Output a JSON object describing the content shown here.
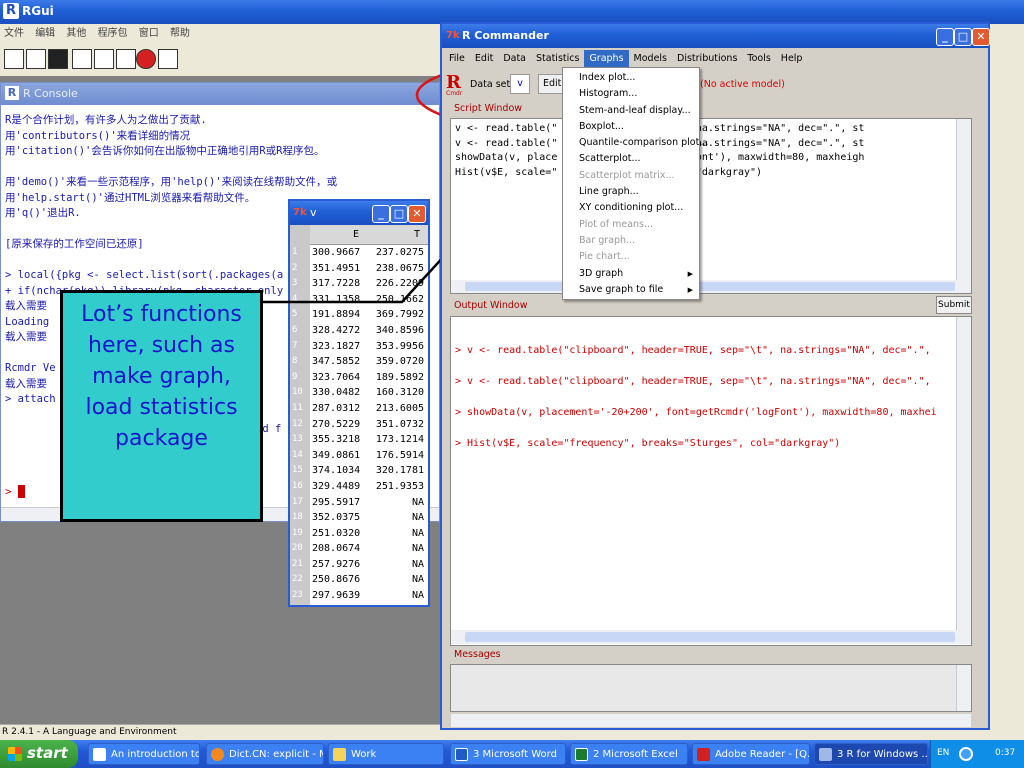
{
  "rgui": {
    "title": "RGui",
    "menu": [
      "文件",
      "编辑",
      "其他",
      "程序包",
      "窗口",
      "帮助"
    ],
    "status": "R 2.4.1 - A Language and Environment"
  },
  "console": {
    "title": "R Console",
    "lines": [
      "R是个合作计划，有许多人为之做出了贡献.",
      "用'contributors()'来看详细的情况",
      "用'citation()'会告诉你如何在出版物中正确地引用R或R程序包。",
      "",
      "用'demo()'来看一些示范程序，用'help()'来阅读在线帮助文件，或",
      "用'help.start()'通过HTML浏览器来看帮助文件。",
      "用'q()'退出R.",
      "",
      "[原来保存的工作空间已还原]",
      "",
      "> local({pkg <- select.list(sort(.packages(a",
      "+ if(nchar(pkg)) library(pkg, character.only",
      "载入需要",
      "Loading",
      "载入需要",
      "",
      "Rcmdr Ve",
      "载入需要",
      "> attach"
    ],
    "extra": "ed f",
    "prompt": ">"
  },
  "viewer": {
    "title": "v",
    "headers": [
      "E",
      "T"
    ],
    "rows": [
      [
        "1",
        "300.9667",
        "237.0275"
      ],
      [
        "2",
        "351.4951",
        "238.0675"
      ],
      [
        "3",
        "317.7228",
        "226.2209"
      ],
      [
        "4",
        "331.1358",
        "250.1662"
      ],
      [
        "5",
        "191.8894",
        "369.7992"
      ],
      [
        "6",
        "328.4272",
        "340.8596"
      ],
      [
        "7",
        "323.1827",
        "353.9956"
      ],
      [
        "8",
        "347.5852",
        "359.0720"
      ],
      [
        "9",
        "323.7064",
        "189.5892"
      ],
      [
        "10",
        "330.0482",
        "160.3120"
      ],
      [
        "11",
        "287.0312",
        "213.6005"
      ],
      [
        "12",
        "270.5229",
        "351.0732"
      ],
      [
        "13",
        "355.3218",
        "173.1214"
      ],
      [
        "14",
        "349.0861",
        "176.5914"
      ],
      [
        "15",
        "374.1034",
        "320.1781"
      ],
      [
        "16",
        "329.4489",
        "251.9353"
      ],
      [
        "17",
        "295.5917",
        "NA"
      ],
      [
        "18",
        "352.0375",
        "NA"
      ],
      [
        "19",
        "251.0320",
        "NA"
      ],
      [
        "20",
        "208.0674",
        "NA"
      ],
      [
        "21",
        "257.9276",
        "NA"
      ],
      [
        "22",
        "250.8676",
        "NA"
      ],
      [
        "23",
        "297.9639",
        "NA"
      ]
    ]
  },
  "callout": "Lot’s functions here, such as make graph, load statistics package",
  "rcmdr": {
    "title": "R Commander",
    "menu": [
      "File",
      "Edit",
      "Data",
      "Statistics",
      "Graphs",
      "Models",
      "Distributions",
      "Tools",
      "Help"
    ],
    "dataset_label": "Data set:",
    "dataset_value": "v",
    "edit_label": "Edit d",
    "model_label": "(No active model)",
    "logo": "R",
    "logo_sub": "Cmdr",
    "script_label": "Script Window",
    "output_label": "Output Window",
    "submit": "Submit",
    "messages_label": "Messages",
    "script_lines": [
      "v <- read.table(\"         UE, sep=\"\\t\", na.strings=\"NA\", dec=\".\", st",
      "v <- read.table(\"         UE, sep=\"\\t\", na.strings=\"NA\", dec=\".\", st",
      "showData(v, place         getRcmdr('logFont'), maxwidth=80, maxheigh",
      "Hist(v$E, scale=\"         Sturges\", col=\"darkgray\")"
    ],
    "output_lines": [
      "> v <- read.table(\"clipboard\", header=TRUE, sep=\"\\t\", na.strings=\"NA\", dec=\".\",",
      "> v <- read.table(\"clipboard\", header=TRUE, sep=\"\\t\", na.strings=\"NA\", dec=\".\",",
      "> showData(v, placement='-20+200', font=getRcmdr('logFont'), maxwidth=80, maxhei",
      "> Hist(v$E, scale=\"frequency\", breaks=\"Sturges\", col=\"darkgray\")"
    ]
  },
  "graphs_menu": [
    {
      "label": "Index plot...",
      "disabled": false
    },
    {
      "label": "Histogram...",
      "disabled": false
    },
    {
      "label": "Stem-and-leaf display...",
      "disabled": false
    },
    {
      "label": "Boxplot...",
      "disabled": false
    },
    {
      "label": "Quantile-comparison plot...",
      "disabled": false
    },
    {
      "label": "Scatterplot...",
      "disabled": false
    },
    {
      "label": "Scatterplot matrix...",
      "disabled": true
    },
    {
      "label": "Line graph...",
      "disabled": false
    },
    {
      "label": "XY conditioning plot...",
      "disabled": false
    },
    {
      "label": "Plot of means...",
      "disabled": true
    },
    {
      "label": "Bar graph...",
      "disabled": true
    },
    {
      "label": "Pie chart...",
      "disabled": true
    },
    {
      "label": "3D graph",
      "disabled": false,
      "arrow": "▶"
    },
    {
      "label": "Save graph to file",
      "disabled": false,
      "arrow": "▶"
    }
  ],
  "taskbar": {
    "start": "start",
    "items": [
      "An introduction to R",
      "Dict.CN: explicit - M...",
      "Work",
      "3 Microsoft Word",
      "2 Microsoft Excel",
      "Adobe Reader - [Q...",
      "3 R for Windows ..."
    ],
    "lang": "EN",
    "clock": "0:37"
  }
}
